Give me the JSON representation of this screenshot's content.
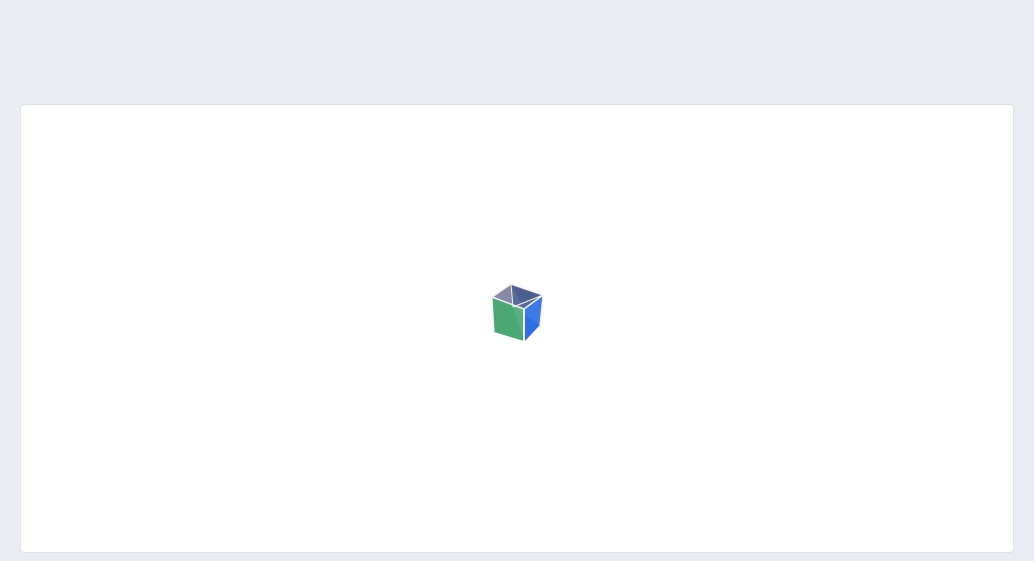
{
  "page": {
    "background_color": "#e9edf1",
    "panel_color": "#ffffff",
    "panel_border_color": "#dde2e7"
  },
  "loader": {
    "icon": "loading-cube-icon",
    "state": "loading",
    "colors": {
      "top_face": "#4b5f91",
      "top_left_face": "#888aa3",
      "left_face": "#4ba874",
      "right_face": "#2f6fe6",
      "edge": "#f2f2f2"
    }
  }
}
